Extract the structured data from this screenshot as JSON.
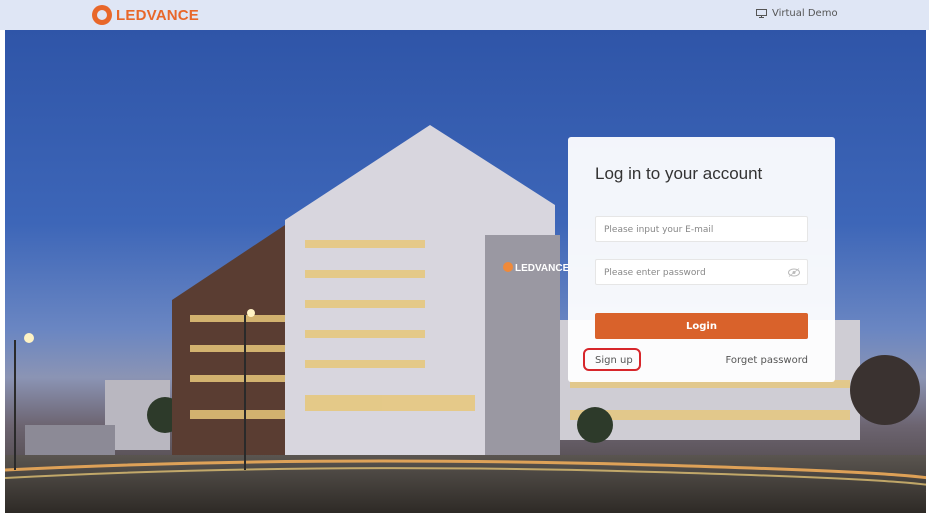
{
  "header": {
    "brand": "LEDVANCE",
    "demo_label": "Virtual Demo"
  },
  "hero": {
    "building_sign": "LEDVANCE"
  },
  "login": {
    "title": "Log in to your account",
    "email_placeholder": "Please input your E-mail",
    "password_placeholder": "Please enter password",
    "login_label": "Login",
    "signup_label": "Sign up",
    "forgot_label": "Forget password"
  },
  "colors": {
    "brand": "#e8672a",
    "button": "#d9622b",
    "highlight": "#d7262b"
  }
}
